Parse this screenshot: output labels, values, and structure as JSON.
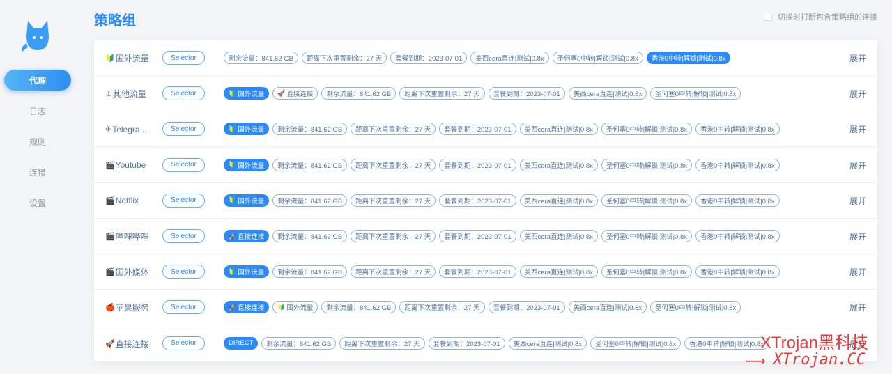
{
  "sidebar": {
    "items": [
      {
        "label": "代理",
        "active": true
      },
      {
        "label": "日志",
        "active": false
      },
      {
        "label": "规则",
        "active": false
      },
      {
        "label": "连接",
        "active": false
      },
      {
        "label": "设置",
        "active": false
      }
    ]
  },
  "header": {
    "title": "策略组",
    "option_label": "切换时打断包含策略组的连接"
  },
  "groups": [
    {
      "emoji": "🔰",
      "name": "国外流量",
      "type": "Selector",
      "chips": [
        {
          "label": "剩余流量：841.62 GB"
        },
        {
          "label": "距离下次重置剩余：27 天"
        },
        {
          "label": "套餐到期：2023-07-01"
        },
        {
          "label": "美西cera直连|测试|0.8x"
        },
        {
          "label": "圣何塞0中转|解锁|测试|0.8x"
        },
        {
          "label": "香港0中转|解锁|测试|0.8x",
          "active": true
        }
      ],
      "expand": "展开"
    },
    {
      "emoji": "⚓",
      "name": "其他流量",
      "type": "Selector",
      "chips": [
        {
          "icon": "🔰",
          "label": "国外流量",
          "active": true
        },
        {
          "icon": "🚀",
          "label": "直接连接"
        },
        {
          "label": "剩余流量：841.62 GB"
        },
        {
          "label": "距离下次重置剩余：27 天"
        },
        {
          "label": "套餐到期：2023-07-01"
        },
        {
          "label": "美西cera直连|测试|0.8x"
        },
        {
          "label": "圣何塞0中转|解锁|测试|0.8x"
        }
      ],
      "expand": "展开"
    },
    {
      "emoji": "✈",
      "name": "Telegra...",
      "type": "Selector",
      "chips": [
        {
          "icon": "🔰",
          "label": "国外流量",
          "active": true
        },
        {
          "label": "剩余流量：841.62 GB"
        },
        {
          "label": "距离下次重置剩余：27 天"
        },
        {
          "label": "套餐到期：2023-07-01"
        },
        {
          "label": "美西cera直连|测试|0.8x"
        },
        {
          "label": "圣何塞0中转|解锁|测试|0.8x"
        },
        {
          "label": "香港0中转|解锁|测试|0.8x"
        }
      ],
      "expand": "展开"
    },
    {
      "emoji": "🎬",
      "name": "Youtube",
      "type": "Selector",
      "chips": [
        {
          "icon": "🔰",
          "label": "国外流量",
          "active": true
        },
        {
          "label": "剩余流量：841.62 GB"
        },
        {
          "label": "距离下次重置剩余：27 天"
        },
        {
          "label": "套餐到期：2023-07-01"
        },
        {
          "label": "美西cera直连|测试|0.8x"
        },
        {
          "label": "圣何塞0中转|解锁|测试|0.8x"
        },
        {
          "label": "香港0中转|解锁|测试|0.8x"
        }
      ],
      "expand": "展开"
    },
    {
      "emoji": "🎬",
      "name": "Netflix",
      "type": "Selector",
      "chips": [
        {
          "icon": "🔰",
          "label": "国外流量",
          "active": true
        },
        {
          "label": "剩余流量：841.62 GB"
        },
        {
          "label": "距离下次重置剩余：27 天"
        },
        {
          "label": "套餐到期：2023-07-01"
        },
        {
          "label": "美西cera直连|测试|0.8x"
        },
        {
          "label": "圣何塞0中转|解锁|测试|0.8x"
        },
        {
          "label": "香港0中转|解锁|测试|0.8x"
        }
      ],
      "expand": "展开"
    },
    {
      "emoji": "🎬",
      "name": "哔哩哔哩",
      "type": "Selector",
      "chips": [
        {
          "icon": "🚀",
          "label": "直接连接",
          "active": true
        },
        {
          "label": "剩余流量：841.62 GB"
        },
        {
          "label": "距离下次重置剩余：27 天"
        },
        {
          "label": "套餐到期：2023-07-01"
        },
        {
          "label": "美西cera直连|测试|0.8x"
        },
        {
          "label": "圣何塞0中转|解锁|测试|0.8x"
        },
        {
          "label": "香港0中转|解锁|测试|0.8x"
        }
      ],
      "expand": "展开"
    },
    {
      "emoji": "🎬",
      "name": "国外媒体",
      "type": "Selector",
      "chips": [
        {
          "icon": "🔰",
          "label": "国外流量",
          "active": true
        },
        {
          "label": "剩余流量：841.62 GB"
        },
        {
          "label": "距离下次重置剩余：27 天"
        },
        {
          "label": "套餐到期：2023-07-01"
        },
        {
          "label": "美西cera直连|测试|0.8x"
        },
        {
          "label": "圣何塞0中转|解锁|测试|0.8x"
        },
        {
          "label": "香港0中转|解锁|测试|0.8x"
        }
      ],
      "expand": "展开"
    },
    {
      "emoji": "🍎",
      "name": "苹果服务",
      "type": "Selector",
      "chips": [
        {
          "icon": "🚀",
          "label": "直接连接",
          "active": true
        },
        {
          "icon": "🔰",
          "label": "国外流量"
        },
        {
          "label": "剩余流量：841.62 GB"
        },
        {
          "label": "距离下次重置剩余：27 天"
        },
        {
          "label": "套餐到期：2023-07-01"
        },
        {
          "label": "美西cera直连|测试|0.8x"
        },
        {
          "label": "圣何塞0中转|解锁|测试|0.8x"
        }
      ],
      "expand": "展开"
    },
    {
      "emoji": "🚀",
      "name": "直接连接",
      "type": "Selector",
      "chips": [
        {
          "label": "DIRECT",
          "active": true
        },
        {
          "label": "剩余流量：841.62 GB"
        },
        {
          "label": "距离下次重置剩余：27 天"
        },
        {
          "label": "套餐到期：2023-07-01"
        },
        {
          "label": "美西cera直连|测试|0.8x"
        },
        {
          "label": "圣何塞0中转|解锁|测试|0.8x"
        },
        {
          "label": "香港0中转|解锁|测试|0.8x"
        }
      ],
      "expand": "展开"
    }
  ],
  "watermark": {
    "line1": "XTrojan黑科技",
    "line2": "XTrojan.CC"
  },
  "colors": {
    "accent": "#2c8af8",
    "text": "#54759a",
    "background": "#f4f5f6"
  }
}
